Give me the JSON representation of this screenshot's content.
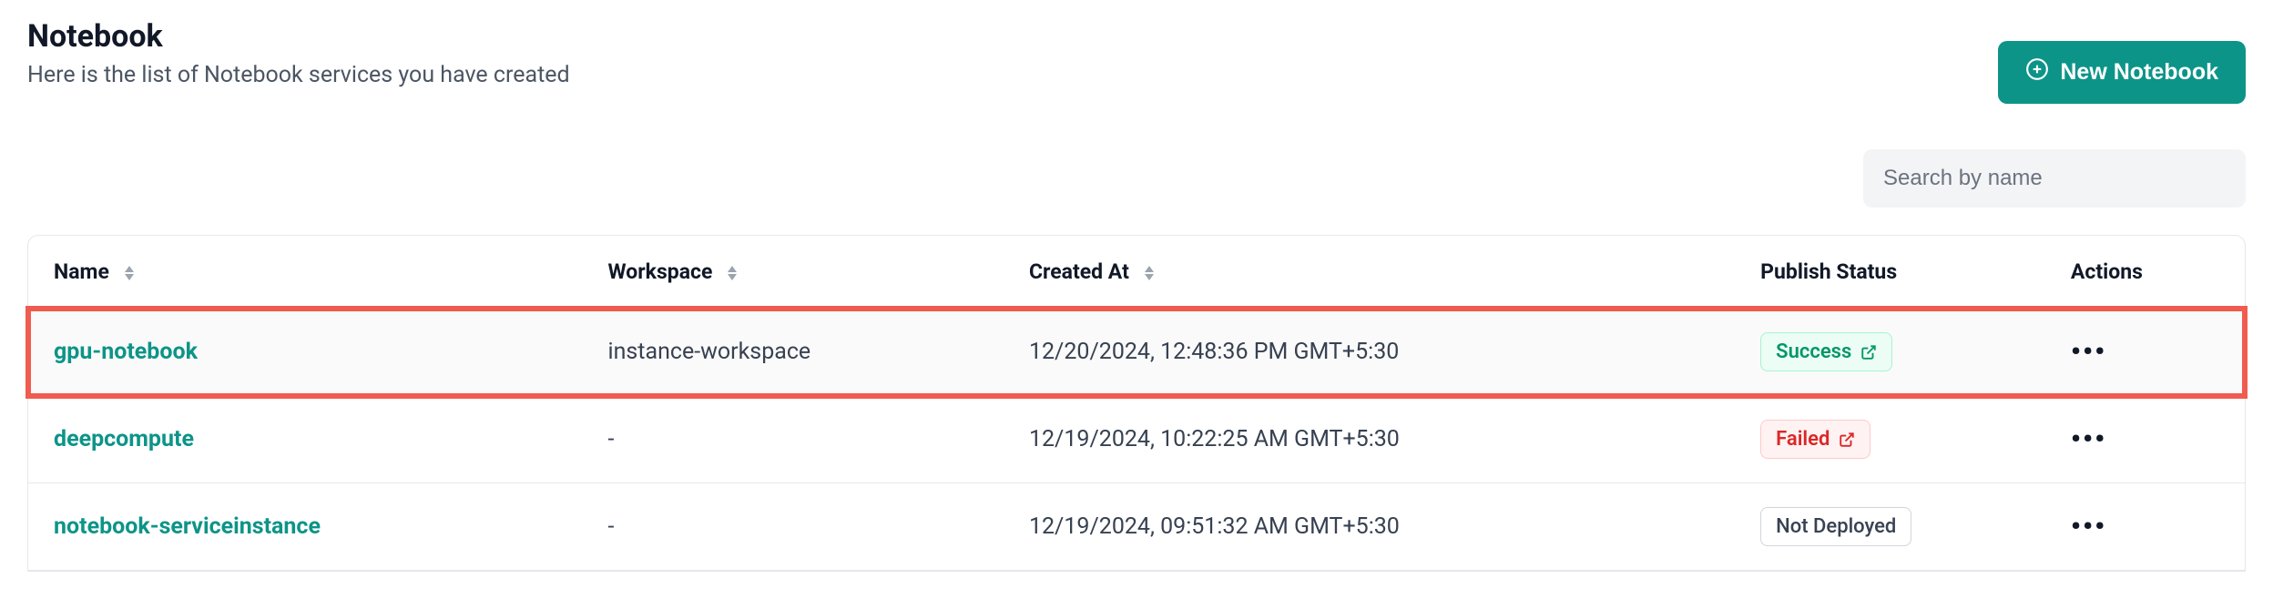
{
  "header": {
    "title": "Notebook",
    "subtitle": "Here is the list of Notebook services you have created",
    "new_button": "New Notebook"
  },
  "search": {
    "placeholder": "Search by name"
  },
  "table": {
    "columns": {
      "name": "Name",
      "workspace": "Workspace",
      "created": "Created At",
      "status": "Publish Status",
      "actions": "Actions"
    },
    "rows": [
      {
        "name": "gpu-notebook",
        "workspace": "instance-workspace",
        "created": "12/20/2024, 12:48:36 PM GMT+5:30",
        "status_label": "Success",
        "status_kind": "success",
        "highlighted": true
      },
      {
        "name": "deepcompute",
        "workspace": "-",
        "created": "12/19/2024, 10:22:25 AM GMT+5:30",
        "status_label": "Failed",
        "status_kind": "failed",
        "highlighted": false
      },
      {
        "name": "notebook-serviceinstance",
        "workspace": "-",
        "created": "12/19/2024, 09:51:32 AM GMT+5:30",
        "status_label": "Not Deployed",
        "status_kind": "neutral",
        "highlighted": false
      }
    ]
  }
}
